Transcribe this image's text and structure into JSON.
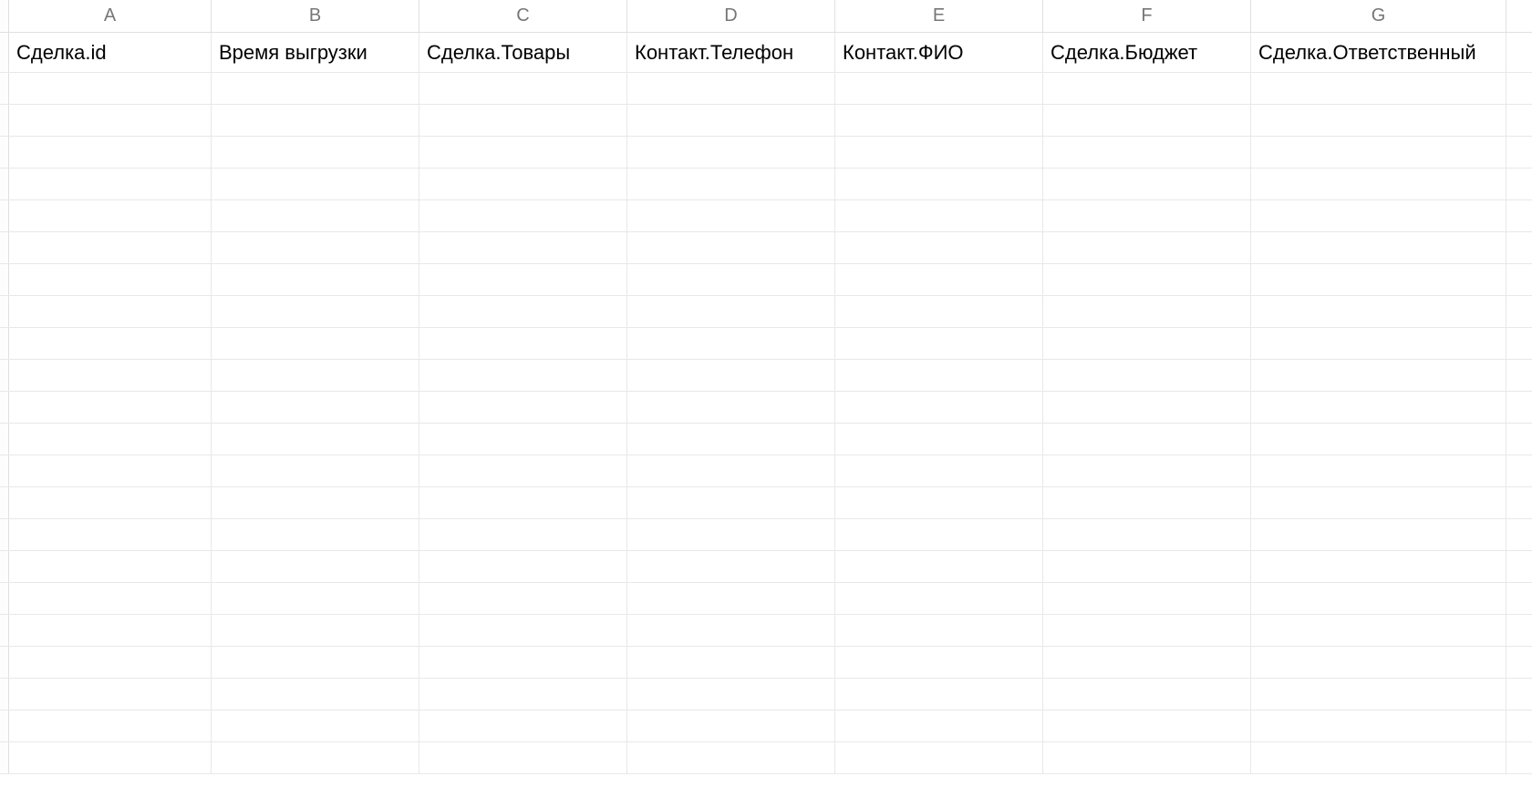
{
  "columns": [
    {
      "letter": "A",
      "width_class": "col-A"
    },
    {
      "letter": "B",
      "width_class": "col-B"
    },
    {
      "letter": "C",
      "width_class": "col-C"
    },
    {
      "letter": "D",
      "width_class": "col-D"
    },
    {
      "letter": "E",
      "width_class": "col-E"
    },
    {
      "letter": "F",
      "width_class": "col-F"
    },
    {
      "letter": "G",
      "width_class": "col-G"
    },
    {
      "letter": "",
      "width_class": "col-H"
    }
  ],
  "header_row": {
    "A": "Сделка.id",
    "B": "Время выгрузки",
    "C": "Сделка.Товары",
    "D": "Контакт.Телефон",
    "E": "Контакт.ФИО",
    "F": "Сделка.Бюджет",
    "G": "Сделка.Ответственный"
  },
  "empty_row_count": 22
}
